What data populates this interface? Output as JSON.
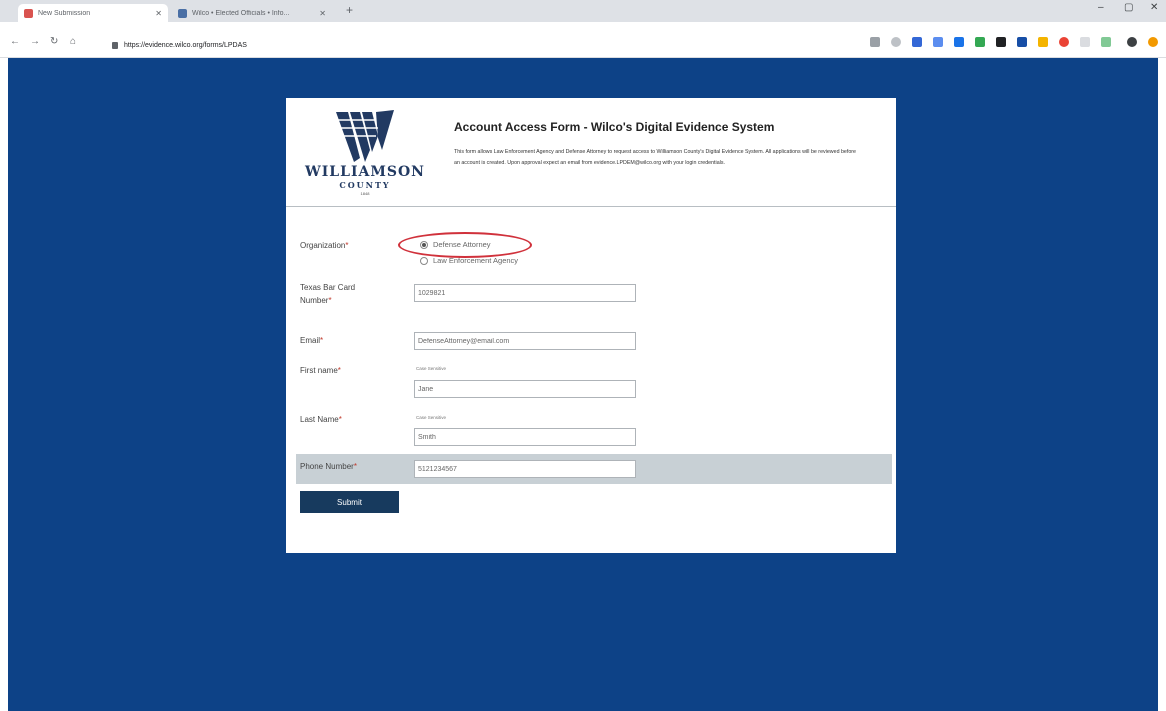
{
  "browser": {
    "tabs": [
      {
        "title": "New Submission",
        "active": true
      },
      {
        "title": "Wilco • Elected Officials • Info...",
        "active": false
      }
    ],
    "address": "https://evidence.wilco.org/forms/LPDAS"
  },
  "form": {
    "logo": {
      "line1": "WILLIAMSON",
      "line2": "COUNTY",
      "line3": "1848"
    },
    "title": "Account Access Form - Wilco's Digital Evidence System",
    "description": "This form allows Law Enforcement Agency and Defense Attorney to request access to Williamson County's Digital Evidence System. All applications will be reviewed before an account is created. Upon approval expect an email from evidence.LPDEM@wilco.org with your login credentials.",
    "organization": {
      "label": "Organization",
      "options": [
        "Defense Attorney",
        "Law Enforcement Agency"
      ],
      "selected": "Defense Attorney"
    },
    "bar_card": {
      "label_line1": "Texas Bar Card",
      "label_line2": "Number",
      "value": "1029821"
    },
    "email": {
      "label": "Email",
      "value": "DefenseAttorney@email.com"
    },
    "first_name": {
      "label": "First name",
      "sublabel": "Case Sensitive",
      "value": "Jane"
    },
    "last_name": {
      "label": "Last Name",
      "sublabel": "Case Sensitive",
      "value": "Smith"
    },
    "phone": {
      "label": "Phone Number",
      "value": "5121234567"
    },
    "required_mark": "*",
    "submit_label": "Submit"
  },
  "colors": {
    "page_bg": "#0d4287",
    "submit_bg": "#173a5e",
    "highlight": "#d0313b"
  }
}
